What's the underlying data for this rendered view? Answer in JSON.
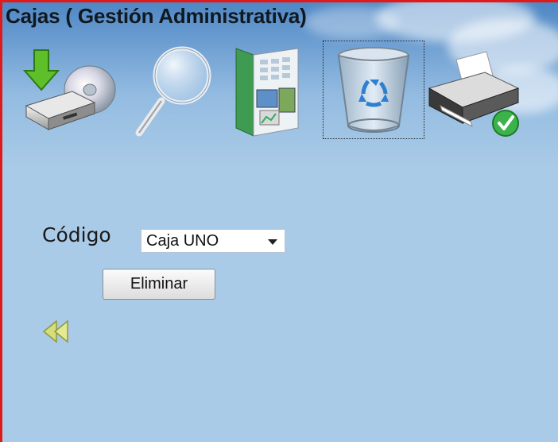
{
  "header": {
    "title": "Cajas ( Gestión Administrativa)"
  },
  "toolbar": {
    "icons": [
      "download-icon",
      "search-icon",
      "report-icon",
      "recycle-bin-icon",
      "printer-icon"
    ],
    "selected": "recycle-bin-icon"
  },
  "form": {
    "codigo_label": "Código",
    "codigo_value": "Caja UNO",
    "eliminar_label": "Eliminar"
  },
  "colors": {
    "frame_border": "#e01a1a",
    "background": "#aacbe7"
  }
}
